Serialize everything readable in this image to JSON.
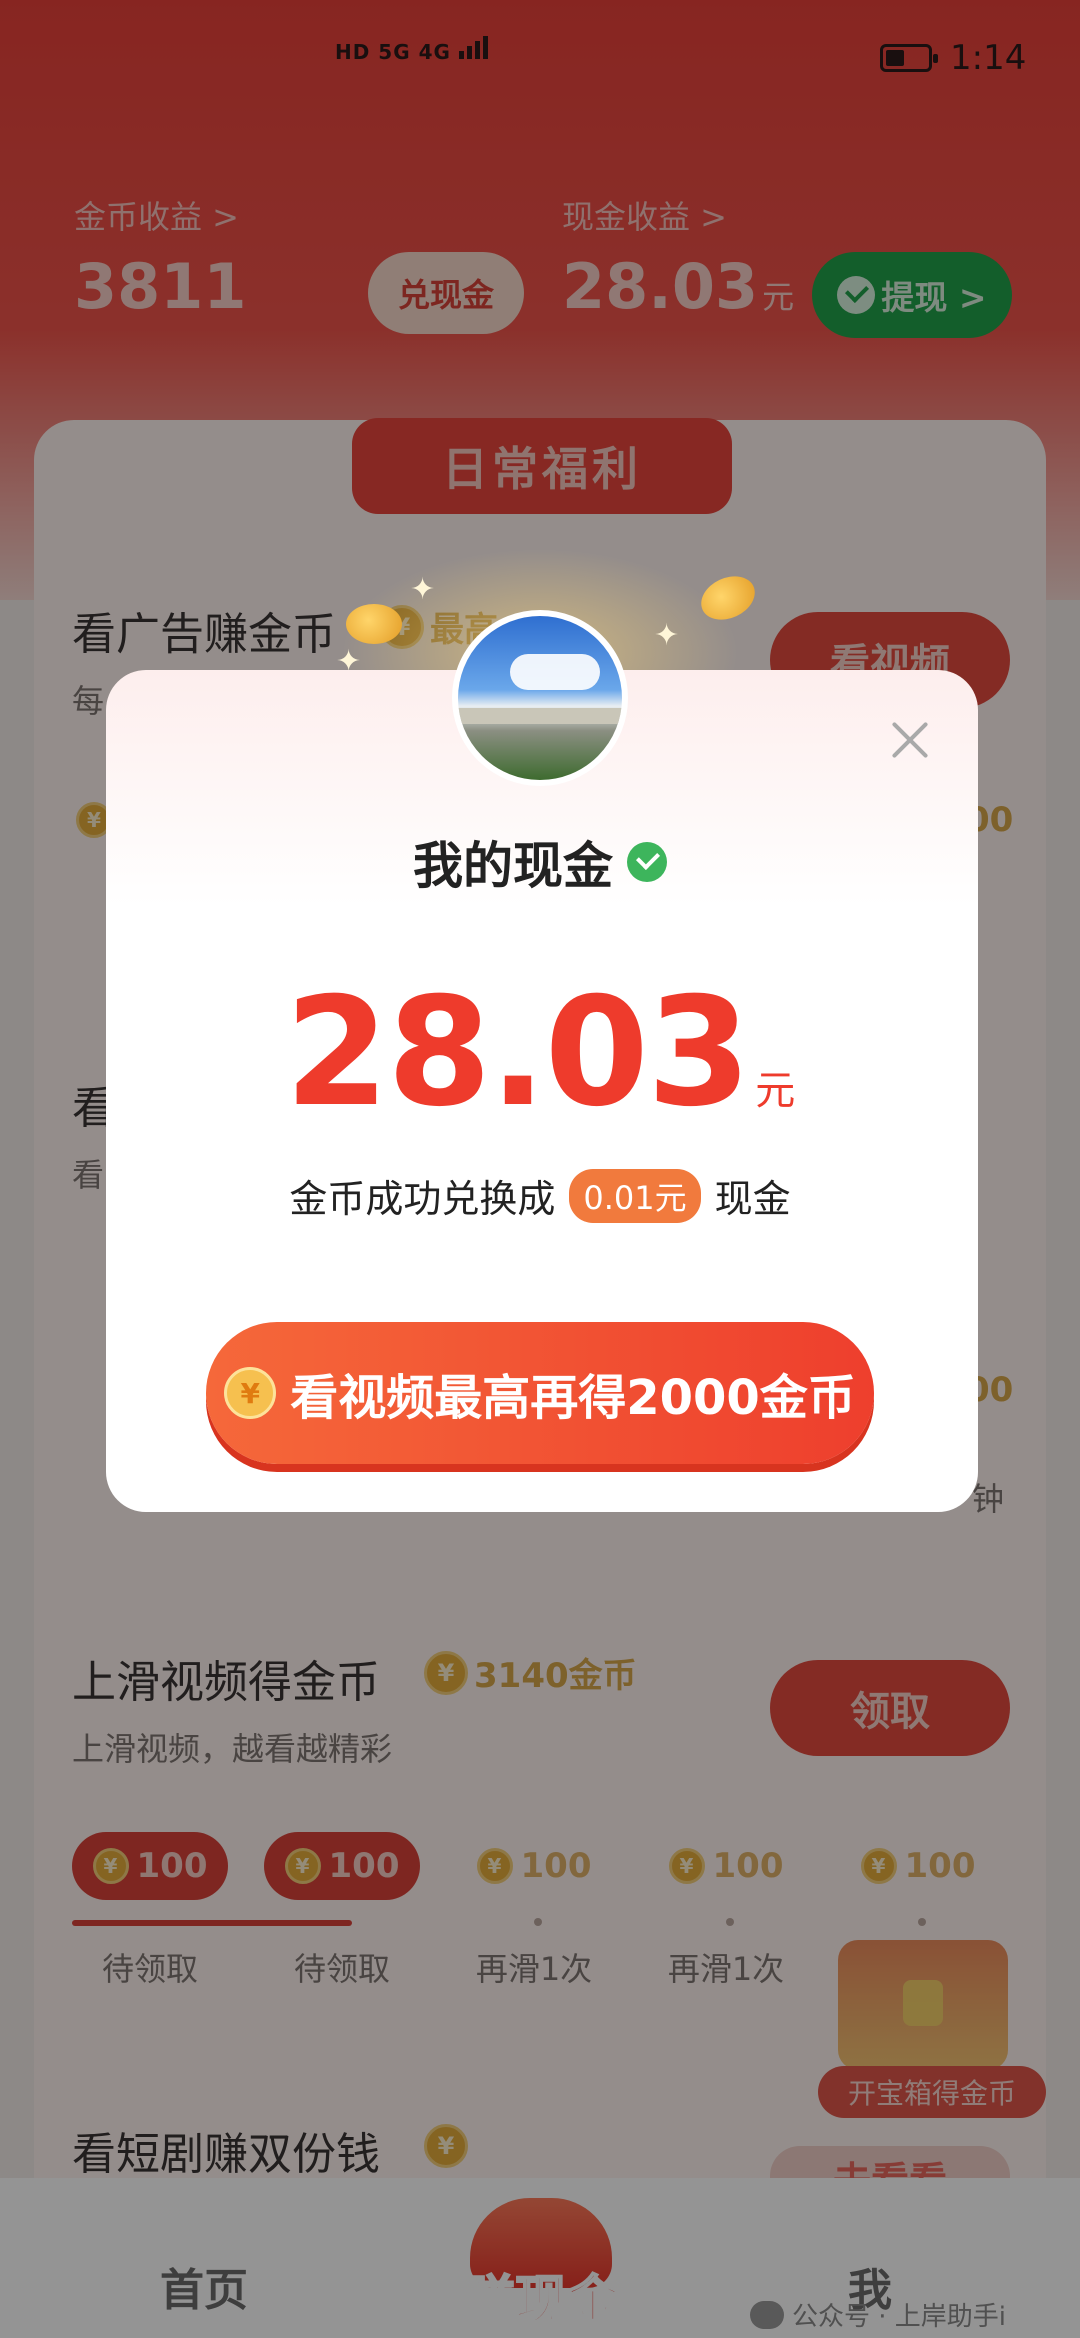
{
  "status_bar": {
    "signal_text": "HD 5G 4G",
    "time": "1:14"
  },
  "header": {
    "coin_label": "金币收益 >",
    "coin_value": "3811",
    "exchange_label": "兑现金",
    "cash_label": "现金收益 >",
    "cash_value": "28.03",
    "cash_unit": "元",
    "withdraw_label": "提现 >"
  },
  "card": {
    "ribbon": "日常福利",
    "task1": {
      "title": "看广告赚金币",
      "badge": "最高",
      "sub": "每",
      "button": "看视频",
      "right_text": "00"
    },
    "task2": {
      "title": "看",
      "sub": "看",
      "right_text": "00",
      "right_sub": "钟"
    },
    "task3": {
      "title": "上滑视频得金币",
      "badge": "3140金币",
      "sub": "上滑视频，越看越精彩",
      "button": "领取"
    },
    "rewards": [
      {
        "value": "100",
        "label": "待领取"
      },
      {
        "value": "100",
        "label": "待领取"
      },
      {
        "value": "100",
        "label": "再滑1次"
      },
      {
        "value": "100",
        "label": "再滑1次"
      },
      {
        "value": "100",
        "label": ""
      }
    ],
    "treasure_label": "开宝箱得金币",
    "task4": {
      "title": "看短剧赚双份钱",
      "button": "去看看"
    }
  },
  "bottom_nav": {
    "home": "首页",
    "earn": "赚现金",
    "me": "我",
    "watermark": "公众号 · 上岸助手i"
  },
  "modal": {
    "title": "我的现金",
    "amount": "28.03",
    "unit": "元",
    "exchange_prefix": "金币成功兑换成",
    "exchange_amount": "0.01元",
    "exchange_suffix": "现金",
    "cta_label": "看视频最高再得2000金币"
  },
  "icons": {
    "coin": "¥",
    "close": "close-icon"
  },
  "colors": {
    "brand_red": "#ee3b2c",
    "cta_orange": "#f5683a",
    "wechat_green": "#21a24a"
  }
}
